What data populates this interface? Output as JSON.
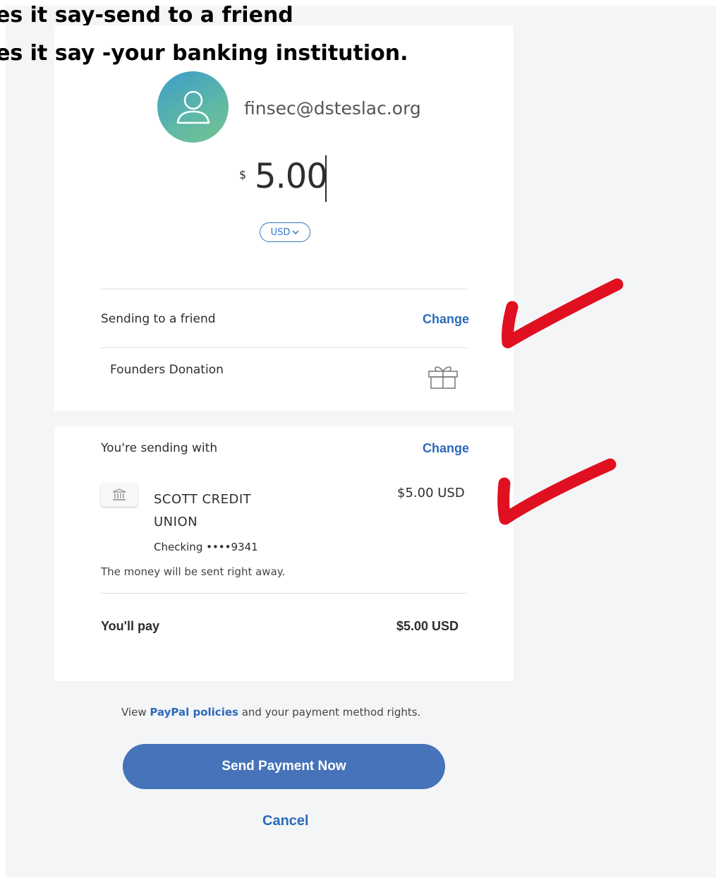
{
  "annotations": {
    "line_1": "es it say-send to a friend",
    "line_2": "es it say -your banking institution."
  },
  "recipient": {
    "email": "finsec@dsteslac.org",
    "avatar_icon": "user-outline-icon"
  },
  "payment": {
    "currency_symbol": "$",
    "amount": "5.00",
    "currency_code": "USD"
  },
  "purpose": {
    "type_label": "Sending to a friend",
    "change_label": "Change",
    "note": "Founders Donation",
    "note_icon": "gift-icon"
  },
  "funding": {
    "header": "You're sending with",
    "change_label": "Change",
    "bank_icon": "bank-icon",
    "bank_name": "SCOTT CREDIT UNION",
    "amount": "$5.00 USD",
    "account": "Checking ••••9341",
    "note": "The money will be sent right away."
  },
  "summary": {
    "label": "You'll pay",
    "amount": "$5.00 USD"
  },
  "policies": {
    "prefix": "View ",
    "link": "PayPal policies",
    "suffix": " and your payment method rights."
  },
  "actions": {
    "send_label": "Send Payment Now",
    "cancel_label": "Cancel"
  },
  "colors": {
    "brand_blue": "#4673b9",
    "link_blue": "#2c6ab9",
    "annotation_red": "#e01020"
  }
}
